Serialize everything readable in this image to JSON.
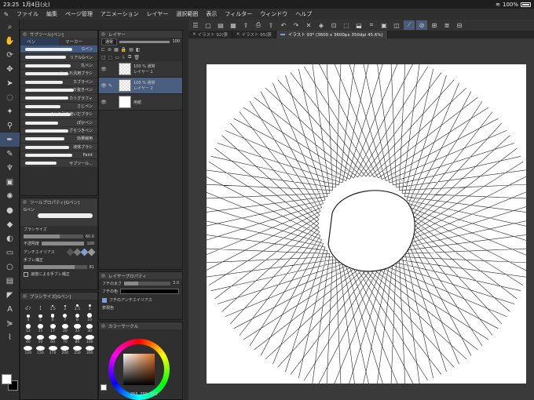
{
  "status": {
    "time": "23:25",
    "date": "1月4日(火)",
    "battery": "100%"
  },
  "menu": [
    "ファイル",
    "編集",
    "ページ管理",
    "アニメーション",
    "レイヤー",
    "選択範囲",
    "表示",
    "フィルター",
    "ウィンドウ",
    "ヘルプ"
  ],
  "tabs": [
    {
      "label": "イラスト 92(張"
    },
    {
      "label": "イラスト 95(張"
    },
    {
      "label": "イラスト 93* (3600 x 3600px 350dpi 45.6%)"
    }
  ],
  "subtool": {
    "title": "サブツール[ペン]",
    "tab_pen": "ペン",
    "tab_marker": "マーカー",
    "brushes": [
      "Gペン",
      "リアルGペン",
      "丸ペン",
      "ペン入れ汎用ブラシ",
      "カブラペン",
      "入り抜きペン",
      "カリグラフィ",
      "さじペン",
      "Aから引き継いだブラシ",
      "ぽかペン",
      "ざらつきペン",
      "効果線用",
      "液体ブラシ",
      "Paint",
      "サブツール..."
    ]
  },
  "tool_property": {
    "title": "ツールプロパティ[Gペン]",
    "preview_label": "Gペン",
    "brush_size_label": "ブラシサイズ",
    "brush_size_value": "60.0",
    "opacity_label": "不透明度",
    "opacity_value": "100",
    "antialias_label": "アンチエイリアス",
    "stabilization_label": "手ブレ補正",
    "stabilization_value": "81",
    "speed_stab_label": "速度による手ブレ補正",
    "brush_size_fraction": 0.6,
    "opacity_fraction": 1.0,
    "stabilization_fraction": 0.81
  },
  "brush_size_panel": {
    "title": "ブラシサイズ[Gペン]",
    "sizes": [
      "0.7",
      "1",
      "1.5",
      "2",
      "2.5",
      "3",
      "4",
      "5",
      "6",
      "7",
      "8",
      "10",
      "12",
      "15",
      "17",
      "20",
      "25",
      "30",
      "40",
      "50",
      "60",
      "70",
      "80",
      "100",
      "120",
      "150",
      "170",
      "200",
      "250",
      "300"
    ]
  },
  "layer_panel": {
    "title": "レイヤー",
    "blend_mode": "通常",
    "opacity": "100",
    "layers": [
      {
        "mode": "100 % 通常",
        "name": "レイヤー 1"
      },
      {
        "mode": "100 % 通常",
        "name": "レイヤー 2"
      },
      {
        "mode": "",
        "name": "用紙"
      }
    ]
  },
  "layer_property": {
    "title": "レイヤープロパティ",
    "border_width_label": "フチの太さ",
    "border_width_value": "3.0",
    "border_color_label": "フチの色",
    "antialias_label": "フチのアンチエイリアス",
    "expression_label": "表現色"
  },
  "color_panel": {
    "title": "カラーサークル",
    "r": "255",
    "g": "255",
    "b": "255"
  }
}
